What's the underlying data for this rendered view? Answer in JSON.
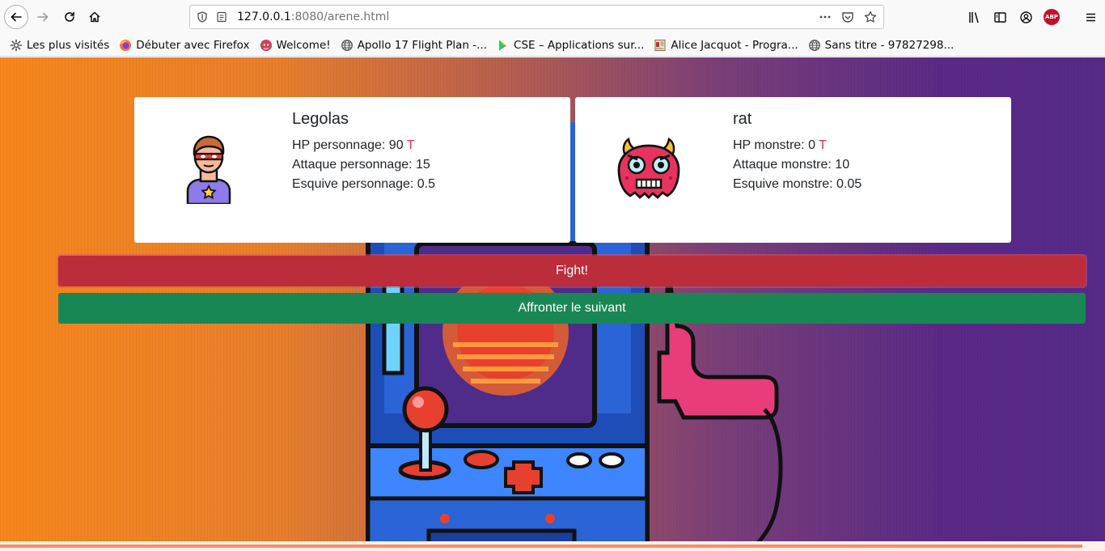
{
  "browser": {
    "url_host": "127.0.0.1",
    "url_rest": ":8080/arene.html",
    "bookmarks": [
      {
        "label": "Les plus visités",
        "icon": "gear-icon"
      },
      {
        "label": "Débuter avec Firefox",
        "icon": "firefox-icon"
      },
      {
        "label": "Welcome!",
        "icon": "octocat-icon"
      },
      {
        "label": "Apollo 17 Flight Plan -...",
        "icon": "globe-icon"
      },
      {
        "label": "CSE – Applications sur...",
        "icon": "play-store-icon"
      },
      {
        "label": "Alice Jacquot - Progra...",
        "icon": "page-icon"
      },
      {
        "label": "Sans titre - 97827298...",
        "icon": "globe-icon"
      }
    ],
    "abp_label": "ABP"
  },
  "player": {
    "name": "Legolas",
    "hp_label": "HP personnage: ",
    "hp_value": "90",
    "hp_tag": "T",
    "attack": "Attaque personnage: 15",
    "dodge": "Esquive personnage: 0.5",
    "icon": "hero-avatar-icon"
  },
  "monster": {
    "name": "rat",
    "hp_label": "HP monstre: ",
    "hp_value": "0",
    "hp_tag": "T",
    "attack": "Attaque monstre: 10",
    "dodge": "Esquive monstre: 0.05",
    "icon": "monster-avatar-icon"
  },
  "actions": {
    "fight_label": "Fight!",
    "next_label": "Affronter le suivant"
  },
  "colors": {
    "fight": "#bb2d3b",
    "next": "#198754",
    "hp_tag": "#dc3545"
  }
}
